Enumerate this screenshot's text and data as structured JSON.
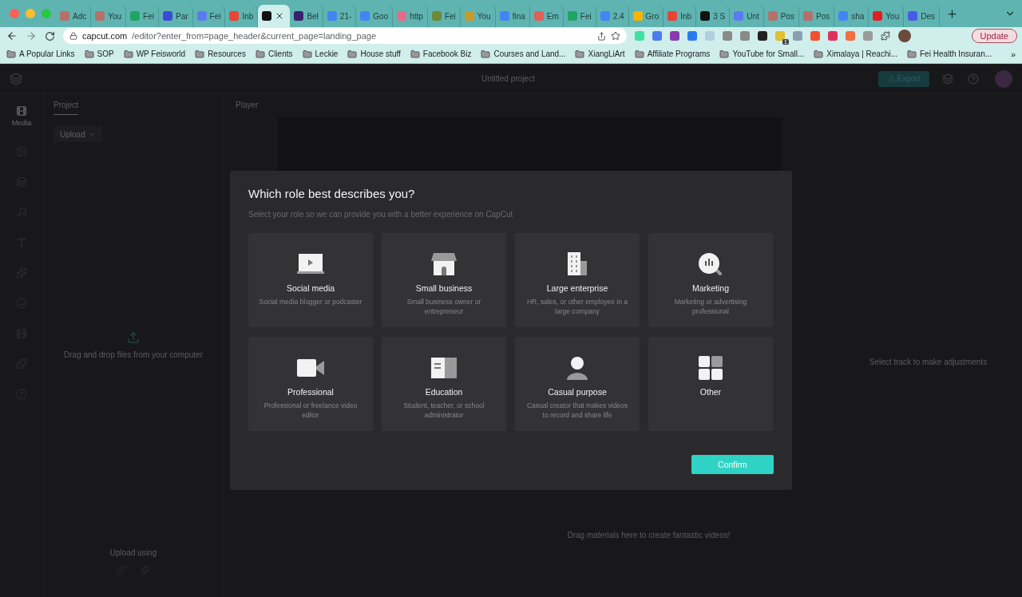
{
  "browser": {
    "tabs": [
      {
        "label": "Adc",
        "color": "#b5706a",
        "selected": false
      },
      {
        "label": "You",
        "color": "#b5706a",
        "selected": false
      },
      {
        "label": "Fei",
        "color": "#1fa463",
        "selected": false
      },
      {
        "label": "Par",
        "color": "#3b4bd8",
        "selected": false
      },
      {
        "label": "Fei",
        "color": "#5a7cf0",
        "selected": false
      },
      {
        "label": "Inb",
        "color": "#ea4335",
        "selected": false
      },
      {
        "color": "#111111",
        "selected": true
      },
      {
        "label": "Bel",
        "color": "#3a1f6e",
        "selected": false
      },
      {
        "label": "21-",
        "color": "#4285f4",
        "selected": false
      },
      {
        "label": "Goo",
        "color": "#4285f4",
        "selected": false
      },
      {
        "label": "http",
        "color": "#e06c8a",
        "selected": false
      },
      {
        "label": "Fei",
        "color": "#6a8a3a",
        "selected": false
      },
      {
        "label": "You",
        "color": "#c79a2a",
        "selected": false
      },
      {
        "label": "fina",
        "color": "#4285f4",
        "selected": false
      },
      {
        "label": "Em",
        "color": "#e0605a",
        "selected": false
      },
      {
        "label": "Fei",
        "color": "#1fa463",
        "selected": false
      },
      {
        "label": "2.4",
        "color": "#4285f4",
        "selected": false
      },
      {
        "label": "Gro",
        "color": "#f4b400",
        "selected": false
      },
      {
        "label": "Inb",
        "color": "#ea4335",
        "selected": false
      },
      {
        "label": "3 S",
        "color": "#111111",
        "selected": false
      },
      {
        "label": "Unt",
        "color": "#5a7cf0",
        "selected": false
      },
      {
        "label": "Pos",
        "color": "#b5706a",
        "selected": false
      },
      {
        "label": "Pos",
        "color": "#b5706a",
        "selected": false
      },
      {
        "label": "sha",
        "color": "#4285f4",
        "selected": false
      },
      {
        "label": "You",
        "color": "#e02020",
        "selected": false
      },
      {
        "label": "Des",
        "color": "#4a5ae8",
        "selected": false
      }
    ],
    "url": {
      "host": "capcut.com",
      "path": "/editor?enter_from=page_header&current_page=landing_page"
    },
    "extension_badge": "1",
    "update_button": "Update",
    "bookmarks": [
      "A Popular Links",
      "SOP",
      "WP Feisworld",
      "Resources",
      "Clients",
      "Leckie",
      "House stuff",
      "Facebook Biz",
      "Courses and Land...",
      "XiangLiArt",
      "Affiliate Programs",
      "YouTube for Small...",
      "Ximalaya | Reachi...",
      "Fei Health Insuran..."
    ],
    "bookmarks_more": "»"
  },
  "editor": {
    "project_title": "Untitled project",
    "export_button": "Export",
    "rail": [
      {
        "label": "Media",
        "selected": true
      }
    ],
    "panel_tabs": [
      {
        "label": "Project",
        "selected": true
      }
    ],
    "upload_button": "Upload",
    "drop_text": "Drag and drop files from your computer",
    "upload_using": "Upload using",
    "player_label": "Player",
    "inspector_text": "Select track to make adjustments",
    "timeline_text": "Drag materials here to create fantastic videos!"
  },
  "dialog": {
    "title": "Which role best describes you?",
    "subtitle": "Select your role so we can provide you with a better experience on CapCut",
    "roles": [
      {
        "kind": "laptop",
        "title": "Social media",
        "description": "Social media blogger or podcaster",
        "selected": false
      },
      {
        "kind": "store",
        "title": "Small business",
        "description": "Small business owner or entrepreneur",
        "selected": false
      },
      {
        "kind": "building",
        "title": "Large enterprise",
        "description": "HR, sales, or other employee in a large company",
        "selected": false
      },
      {
        "kind": "analytics",
        "title": "Marketing",
        "description": "Marketing or advertising professional",
        "selected": false
      },
      {
        "kind": "camera",
        "title": "Professional",
        "description": "Professional or freelance video editor",
        "selected": false
      },
      {
        "kind": "book",
        "title": "Education",
        "description": "Student, teacher, or school administrator",
        "selected": false
      },
      {
        "kind": "person",
        "title": "Casual purpose",
        "description": "Casual creator that makes videos to record and share life",
        "selected": false
      },
      {
        "kind": "grid",
        "title": "Other",
        "selected": false
      }
    ],
    "confirm_button": "Confirm"
  }
}
